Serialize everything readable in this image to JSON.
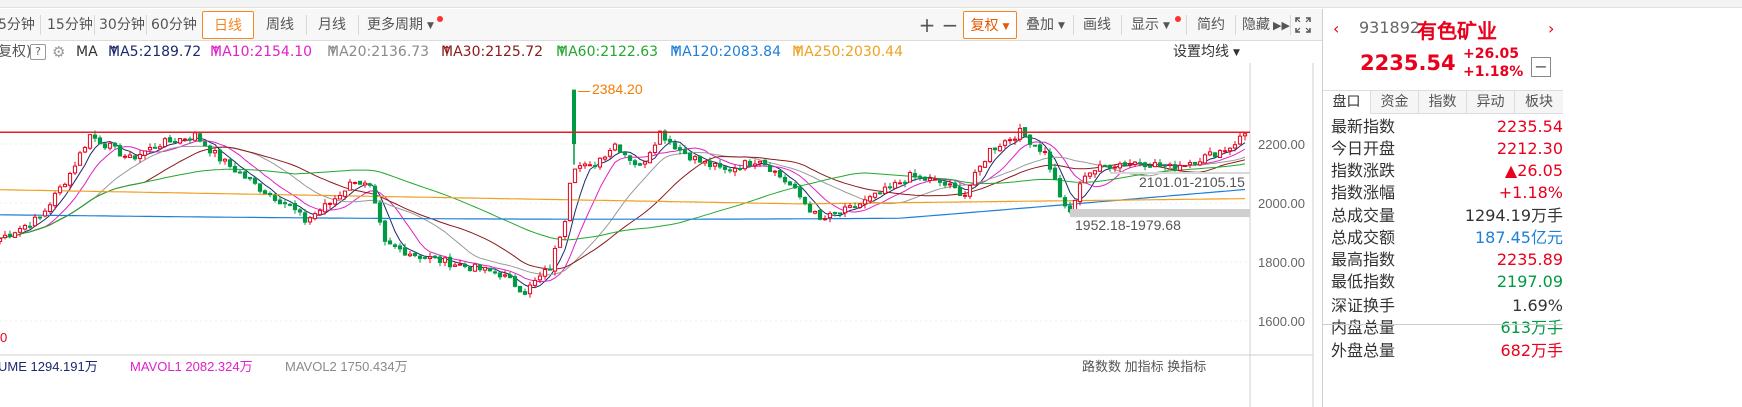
{
  "toolbar": {
    "periods": [
      "5分钟",
      "15分钟",
      "30分钟",
      "60分钟",
      "日线",
      "周线",
      "月线",
      "更多周期"
    ],
    "active_period": "日线",
    "zoom_in": "+",
    "zoom_out": "−",
    "fuquan": "复权",
    "overlay": "叠加",
    "draw_line": "画线",
    "display": "显示",
    "simple": "简约",
    "hide": "隐藏"
  },
  "ma_legend": {
    "prefix": "复权)",
    "ma": "MA",
    "ma5": "MA5:2189.72",
    "ma10": "MA10:2154.10",
    "ma20": "MA20:2136.73",
    "ma30": "MA30:2125.72",
    "ma60": "MA60:2122.63",
    "ma120": "MA120:2083.84",
    "ma250": "MA250:2030.44",
    "set_ma": "设置均线"
  },
  "chart": {
    "price_axis": [
      "2200.00",
      "2000.00",
      "1800.00",
      "1600.00"
    ],
    "high_annotation": "2384.20",
    "gap_annotation_1": "2101.01-2105.15",
    "gap_annotation_2": "1952.18-1979.68",
    "left_edge_label": "0",
    "resistance_price": 2240,
    "colors": {
      "up": "#e8001c",
      "down": "#009944",
      "ma5": "#1a2a6c",
      "ma10": "#e020c8",
      "ma20": "#9a9a9a",
      "ma30": "#8b1a1a",
      "ma60": "#22a82e",
      "ma120": "#1e7fd8",
      "ma250": "#f0a020",
      "resistance": "#e51c23"
    }
  },
  "volume_legend": {
    "v1": "UME 1294.191万",
    "v2": "MAVOL1 2082.324万",
    "v3": "MAVOL2 1750.434万",
    "trailing": "路数数  加指标  换指标"
  },
  "right_panel": {
    "code": "931892",
    "name": "有色矿业",
    "price": "2235.54",
    "change": "+26.05",
    "change_pct": "+1.18%",
    "minus": "−",
    "tabs": [
      "盘口",
      "资金",
      "指数",
      "异动",
      "板块"
    ],
    "rows": [
      {
        "label": "最新指数",
        "value": "2235.54",
        "color": "#e8001c"
      },
      {
        "label": "今日开盘",
        "value": "2212.30",
        "color": "#e8001c"
      },
      {
        "label": "指数涨跌",
        "value": "▲26.05",
        "color": "#e8001c"
      },
      {
        "label": "指数涨幅",
        "value": "+1.18%",
        "color": "#e8001c"
      },
      {
        "label": "总成交量",
        "value": "1294.19万手",
        "color": "#333333"
      },
      {
        "label": "总成交额",
        "value": "187.45亿元",
        "color": "#1e7fd8"
      },
      {
        "label": "最高指数",
        "value": "2235.89",
        "color": "#e8001c"
      },
      {
        "label": "最低指数",
        "value": "2197.09",
        "color": "#009944"
      },
      {
        "label": "深证换手",
        "value": "1.69%",
        "color": "#333333"
      },
      {
        "label": "内盘总量",
        "value": "613万手",
        "color": "#009944"
      },
      {
        "label": "外盘总量",
        "value": "682万手",
        "color": "#e8001c"
      }
    ]
  }
}
